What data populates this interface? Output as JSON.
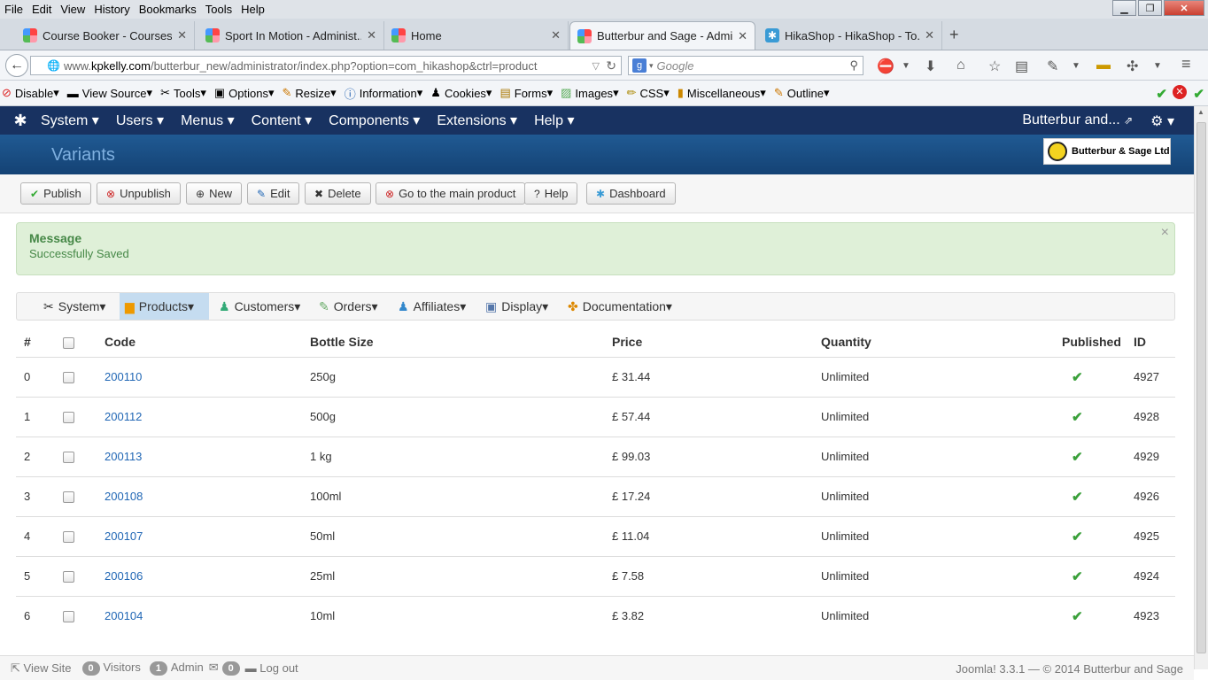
{
  "browser": {
    "menu": [
      "File",
      "Edit",
      "View",
      "History",
      "Bookmarks",
      "Tools",
      "Help"
    ],
    "tabs": [
      {
        "label": "Course Booker - Courses"
      },
      {
        "label": "Sport In Motion - Administ..."
      },
      {
        "label": "Home"
      },
      {
        "label": "Butterbur and Sage - Admi..."
      },
      {
        "label": "HikaShop - HikaShop - To..."
      }
    ],
    "url_prefix": "www.",
    "url_domain": "kpkelly.com",
    "url_path": "/butterbur_new/administrator/index.php?option=com_hikashop&ctrl=product",
    "search_placeholder": "Google",
    "devtools": [
      "Disable",
      "View Source",
      "Tools",
      "Options",
      "Resize",
      "Information",
      "Cookies",
      "Forms",
      "Images",
      "CSS",
      "Miscellaneous",
      "Outline"
    ]
  },
  "joomla": {
    "nav": [
      "System",
      "Users",
      "Menus",
      "Content",
      "Components",
      "Extensions",
      "Help"
    ],
    "site_name": "Butterbur and...",
    "page_title": "Variants",
    "brand": "Butterbur & Sage Ltd",
    "toolbar": [
      "Publish",
      "Unpublish",
      "New",
      "Edit",
      "Delete",
      "Go to the main product",
      "Help",
      "Dashboard"
    ],
    "message": {
      "heading": "Message",
      "text": "Successfully Saved"
    },
    "hika_menu": [
      "System",
      "Products",
      "Customers",
      "Orders",
      "Affiliates",
      "Display",
      "Documentation"
    ]
  },
  "table": {
    "headers": [
      "#",
      "",
      "Code",
      "Bottle Size",
      "Price",
      "Quantity",
      "Published",
      "ID"
    ],
    "rows": [
      {
        "n": "0",
        "code": "200110",
        "size": "250g",
        "price": "£ 31.44",
        "qty": "Unlimited",
        "id": "4927"
      },
      {
        "n": "1",
        "code": "200112",
        "size": "500g",
        "price": "£ 57.44",
        "qty": "Unlimited",
        "id": "4928"
      },
      {
        "n": "2",
        "code": "200113",
        "size": "1 kg",
        "price": "£ 99.03",
        "qty": "Unlimited",
        "id": "4929"
      },
      {
        "n": "3",
        "code": "200108",
        "size": "100ml",
        "price": "£ 17.24",
        "qty": "Unlimited",
        "id": "4926"
      },
      {
        "n": "4",
        "code": "200107",
        "size": "50ml",
        "price": "£ 11.04",
        "qty": "Unlimited",
        "id": "4925"
      },
      {
        "n": "5",
        "code": "200106",
        "size": "25ml",
        "price": "£ 7.58",
        "qty": "Unlimited",
        "id": "4924"
      },
      {
        "n": "6",
        "code": "200104",
        "size": "10ml",
        "price": "£ 3.82",
        "qty": "Unlimited",
        "id": "4923"
      }
    ]
  },
  "status": {
    "view_site": "View Site",
    "visitors_count": "0",
    "visitors": "Visitors",
    "admin_count": "1",
    "admin": "Admin",
    "msg_count": "0",
    "logout": "Log out",
    "footer": "Joomla! 3.3.1 — © 2014 Butterbur and Sage"
  }
}
